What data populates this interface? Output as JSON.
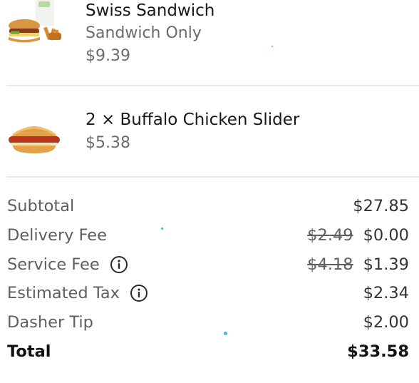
{
  "items": [
    {
      "name": "Swiss Sandwich",
      "option": "Sandwich Only",
      "price": "$9.39",
      "image_icon": "combo-meal-icon"
    },
    {
      "name": "2 × Buffalo Chicken Slider",
      "price": "$5.38",
      "image_icon": "slider-burger-icon"
    }
  ],
  "summary": {
    "subtotal": {
      "label": "Subtotal",
      "value": "$27.85"
    },
    "delivery_fee": {
      "label": "Delivery Fee",
      "original": "$2.49",
      "value": "$0.00"
    },
    "service_fee": {
      "label": "Service Fee",
      "original": "$4.18",
      "value": "$1.39",
      "icon": "info-icon"
    },
    "estimated_tax": {
      "label": "Estimated Tax",
      "value": "$2.34",
      "icon": "info-icon"
    },
    "dasher_tip": {
      "label": "Dasher Tip",
      "value": "$2.00"
    },
    "total": {
      "label": "Total",
      "value": "$33.58"
    }
  },
  "colors": {
    "primary_text": "#191919",
    "secondary_text": "#6b6b6b",
    "divider": "#e9e9e9"
  }
}
